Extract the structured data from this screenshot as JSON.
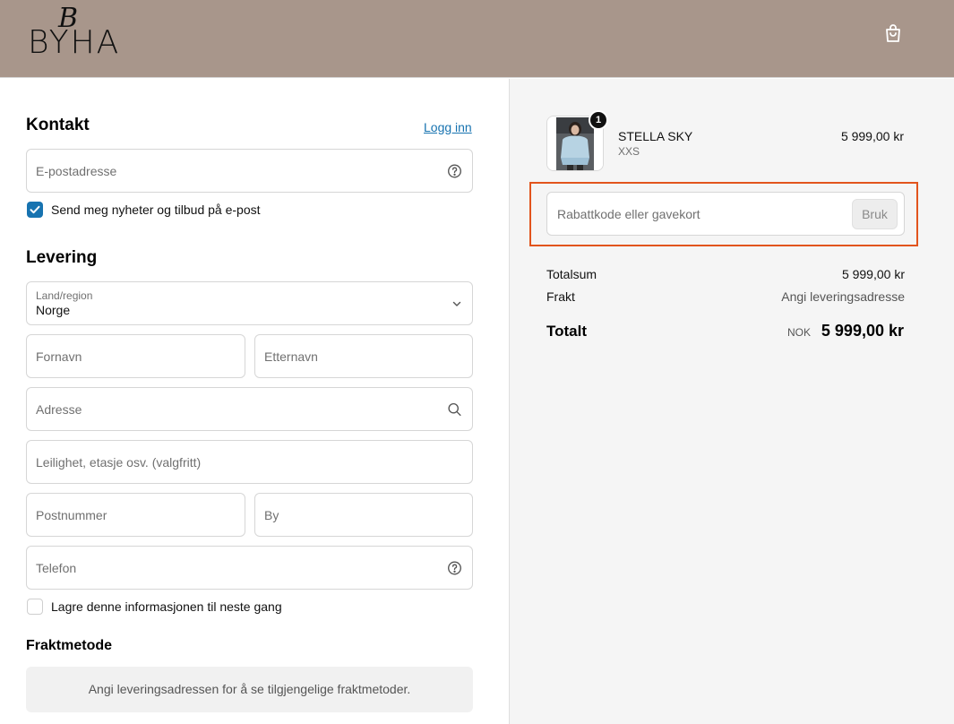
{
  "header": {
    "logo_text": "BYHA",
    "logo_flourish": "B",
    "cart_icon": "shopping-bag-icon"
  },
  "contact": {
    "title": "Kontakt",
    "login_link": "Logg inn",
    "email_placeholder": "E-postadresse",
    "newsletter_label": "Send meg nyheter og tilbud på e-post",
    "newsletter_checked": true
  },
  "delivery": {
    "title": "Levering",
    "country_label": "Land/region",
    "country_value": "Norge",
    "first_name_placeholder": "Fornavn",
    "last_name_placeholder": "Etternavn",
    "address_placeholder": "Adresse",
    "apartment_placeholder": "Leilighet, etasje osv. (valgfritt)",
    "postal_placeholder": "Postnummer",
    "city_placeholder": "By",
    "phone_placeholder": "Telefon",
    "save_info_label": "Lagre denne informasjonen til neste gang",
    "save_info_checked": false
  },
  "shipping": {
    "title": "Fraktmetode",
    "notice": "Angi leveringsadressen for å se tilgjengelige fraktmetoder."
  },
  "summary": {
    "product": {
      "name": "STELLA SKY",
      "variant": "XXS",
      "price": "5 999,00 kr",
      "quantity": "1"
    },
    "discount_placeholder": "Rabattkode eller gavekort",
    "apply_label": "Bruk",
    "subtotal_label": "Totalsum",
    "subtotal_value": "5 999,00 kr",
    "shipping_label": "Frakt",
    "shipping_value": "Angi leveringsadresse",
    "total_label": "Totalt",
    "total_currency": "NOK",
    "total_value": "5 999,00 kr"
  },
  "colors": {
    "header_bg": "#a8968b",
    "accent": "#1773b0",
    "highlight": "#e2541d"
  }
}
